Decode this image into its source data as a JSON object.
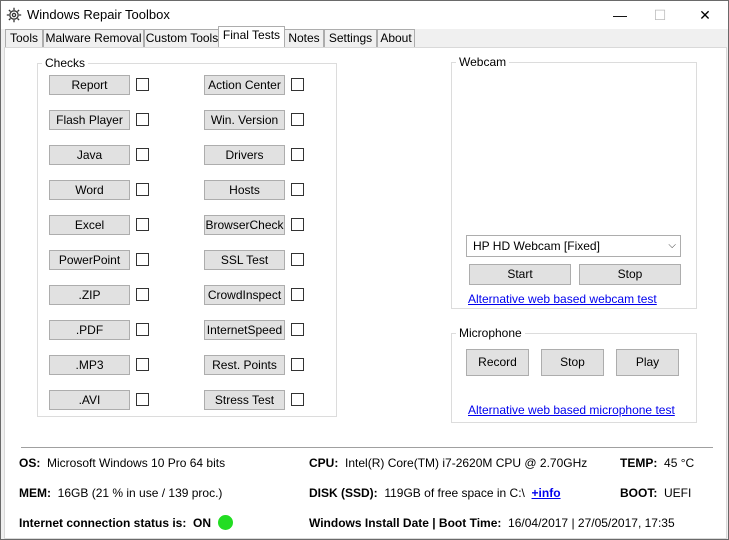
{
  "window": {
    "title": "Windows Repair Toolbox",
    "minimize": "—",
    "maximize": "☐",
    "close": "✕"
  },
  "tabs": [
    {
      "label": "Tools",
      "active": false
    },
    {
      "label": "Malware Removal",
      "active": false
    },
    {
      "label": "Custom Tools",
      "active": false
    },
    {
      "label": "Final Tests",
      "active": true
    },
    {
      "label": "Notes",
      "active": false
    },
    {
      "label": "Settings",
      "active": false
    },
    {
      "label": "About",
      "active": false
    }
  ],
  "checks": {
    "legend": "Checks",
    "left": [
      "Report",
      "Flash Player",
      "Java",
      "Word",
      "Excel",
      "PowerPoint",
      ".ZIP",
      ".PDF",
      ".MP3",
      ".AVI"
    ],
    "right": [
      "Action Center",
      "Win. Version",
      "Drivers",
      "Hosts",
      "BrowserCheck",
      "SSL Test",
      "CrowdInspect",
      "InternetSpeed",
      "Rest. Points",
      "Stress Test"
    ]
  },
  "webcam": {
    "legend": "Webcam",
    "device": "HP HD Webcam [Fixed]",
    "start_label": "Start",
    "stop_label": "Stop",
    "alt_link": "Alternative web based webcam test"
  },
  "microphone": {
    "legend": "Microphone",
    "record_label": "Record",
    "stop_label": "Stop",
    "play_label": "Play",
    "alt_link": "Alternative web based microphone test"
  },
  "sysinfo": {
    "os_label": "OS:",
    "os_value": "Microsoft Windows 10 Pro 64 bits",
    "cpu_label": "CPU:",
    "cpu_value": "Intel(R) Core(TM) i7-2620M CPU @ 2.70GHz",
    "temp_label": "TEMP:",
    "temp_value": "45 °C",
    "mem_label": "MEM:",
    "mem_value": "16GB  (21 % in use / 139 proc.)",
    "disk_label": "DISK (SSD):",
    "disk_value": "119GB of free space in C:\\",
    "disk_link": "+info",
    "boot_label": "BOOT:",
    "boot_value": "UEFI",
    "net_label": "Internet connection status is:",
    "net_value": "ON",
    "net_color": "#22dd22",
    "install_label": "Windows Install Date | Boot Time:",
    "install_value": "16/04/2017  |  27/05/2017, 17:35"
  }
}
